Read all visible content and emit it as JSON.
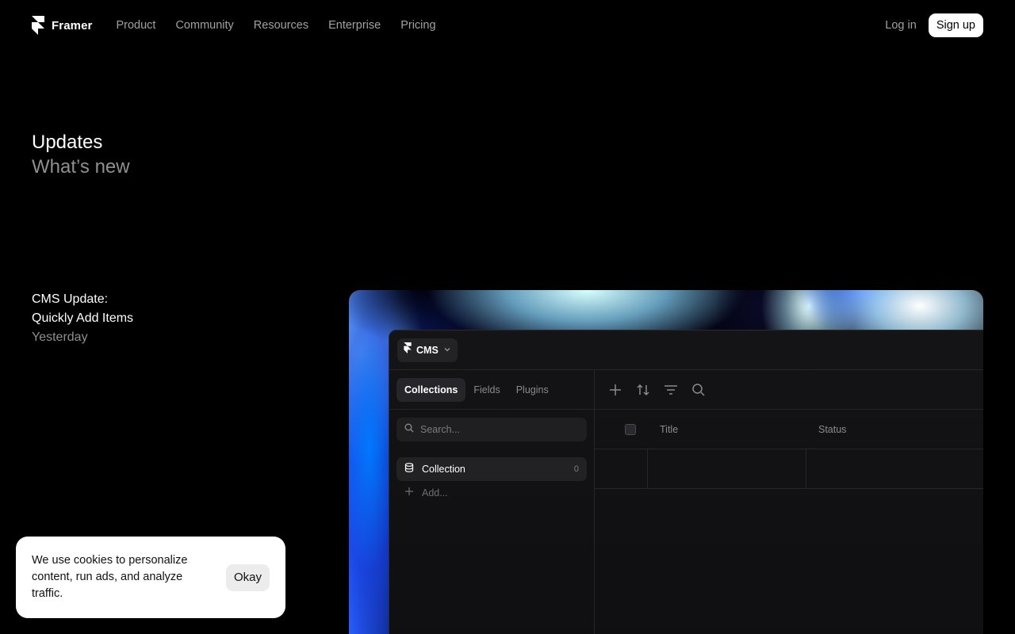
{
  "nav": {
    "brand": "Framer",
    "links": [
      "Product",
      "Community",
      "Resources",
      "Enterprise",
      "Pricing"
    ],
    "login": "Log in",
    "signup": "Sign up"
  },
  "hero": {
    "title": "Updates",
    "subtitle": "What’s new"
  },
  "post": {
    "title_line1": "CMS Update:",
    "title_line2": "Quickly Add Items",
    "date": "Yesterday"
  },
  "cms": {
    "menu_label": "CMS",
    "tabs": [
      "Collections",
      "Fields",
      "Plugins"
    ],
    "search_placeholder": "Search...",
    "collection_label": "Collection",
    "collection_count": "0",
    "add_label": "Add...",
    "columns": [
      "Title",
      "Status"
    ]
  },
  "cookie": {
    "text": "We use cookies to personalize content, run ads, and analyze traffic.",
    "button": "Okay"
  }
}
